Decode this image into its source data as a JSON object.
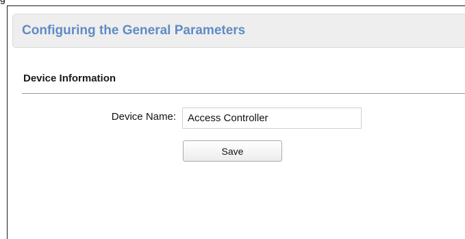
{
  "caption_fragment": "g",
  "header": {
    "title": "Configuring the General Parameters"
  },
  "section": {
    "title": "Device Information"
  },
  "form": {
    "device_name_label": "Device Name:",
    "device_name_value": "Access Controller",
    "save_label": "Save"
  },
  "colors": {
    "title_accent": "#5f8bc5",
    "header_background": "#eeeeee"
  }
}
